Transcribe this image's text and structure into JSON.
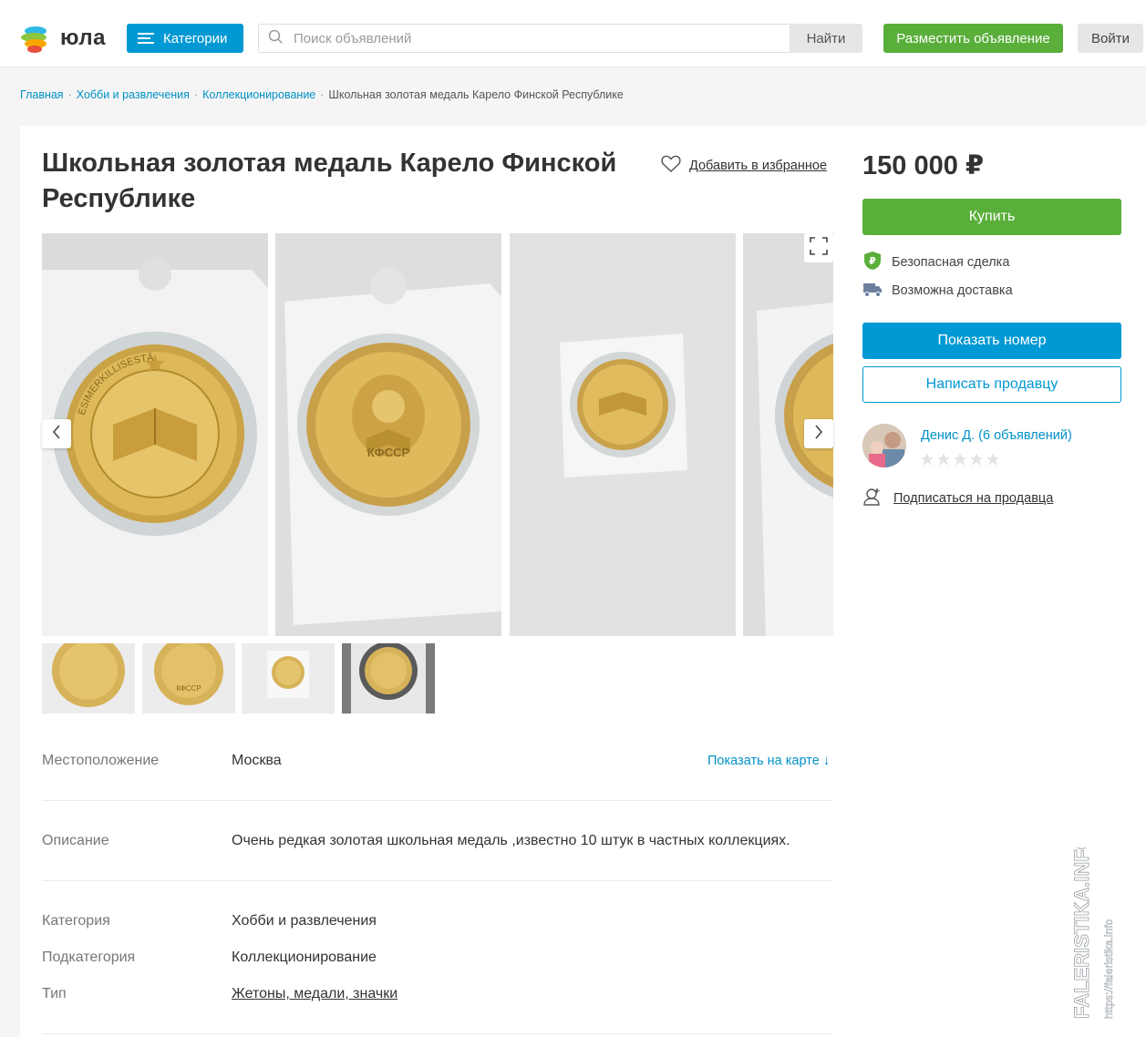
{
  "header": {
    "logo_text": "юла",
    "categories_label": "Категории",
    "search_placeholder": "Поиск объявлений",
    "find_label": "Найти",
    "post_ad_label": "Разместить объявление",
    "login_label": "Войти"
  },
  "breadcrumbs": [
    "Главная",
    "Хобби и развлечения",
    "Коллекционирование",
    "Школьная золотая медаль Карело Финской Республике"
  ],
  "listing": {
    "title": "Школьная золотая медаль Карело Финской Республике",
    "favorite_label": "Добавить в избранное",
    "photos": [
      {
        "medal_text": "ESIMERKILLISESTÄ"
      },
      {
        "medal_text": "КФССР"
      },
      {
        "medal_text": ""
      },
      {
        "medal_text": ""
      }
    ],
    "thumbnails": [
      {
        "medal_text": ""
      },
      {
        "medal_text": "КФССР"
      },
      {
        "medal_text": ""
      },
      {
        "medal_text": ""
      }
    ]
  },
  "details": {
    "location_label": "Местоположение",
    "location_value": "Москва",
    "map_link": "Показать на карте",
    "map_arrow": "↓",
    "description_label": "Описание",
    "description_value": "Очень редкая золотая школьная медаль ,известно 10 штук в частных коллекциях.",
    "category_label": "Категория",
    "category_value": "Хобби и развлечения",
    "subcategory_label": "Подкатегория",
    "subcategory_value": "Коллекционирование",
    "type_label": "Тип",
    "type_value": "Жетоны, медали, значки"
  },
  "sidebar": {
    "price": "150 000 ₽",
    "buy_label": "Купить",
    "safe_deal": "Безопасная сделка",
    "delivery": "Возможна доставка",
    "show_phone": "Показать номер",
    "write_seller": "Написать продавцу",
    "seller_name": "Денис Д. (6 объявлений)",
    "rating": 0,
    "subscribe": "Подписаться на продавца"
  },
  "watermark": {
    "line1": "FALERISTIKA.INFO",
    "line2": "https://faleristika.info"
  },
  "colors": {
    "blue": "#0099d4",
    "green": "#5aaf3b",
    "link": "#0091c6"
  }
}
